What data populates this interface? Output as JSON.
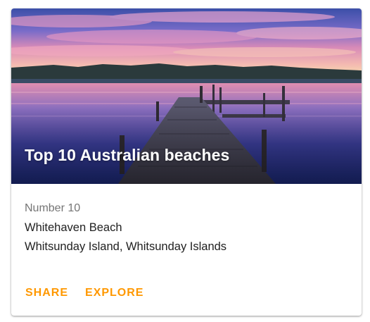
{
  "card": {
    "title": "Top 10 Australian beaches",
    "subtitle": "Number 10",
    "line1": "Whitehaven Beach",
    "line2": "Whitsunday Island, Whitsunday Islands",
    "actions": {
      "share_label": "SHARE",
      "explore_label": "EXPLORE"
    }
  },
  "colors": {
    "accent": "#ff9800",
    "subtitle": "#757575",
    "body_text": "#212121"
  }
}
